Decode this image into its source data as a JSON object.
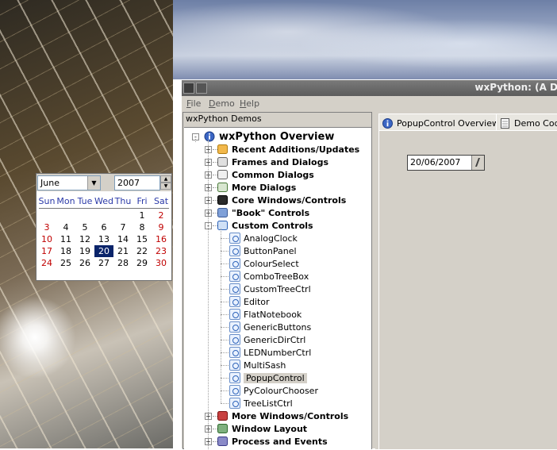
{
  "window": {
    "title": "wxPython: (A D",
    "menu": [
      {
        "accel": "F",
        "rest": "ile"
      },
      {
        "accel": "D",
        "rest": "emo"
      },
      {
        "accel": "H",
        "rest": "elp"
      }
    ]
  },
  "tree": {
    "caption": "wxPython Demos",
    "root": "wxPython Overview",
    "top_groups": [
      "Recent Additions/Updates",
      "Frames and Dialogs",
      "Common Dialogs",
      "More Dialogs",
      "Core Windows/Controls",
      "\"Book\" Controls",
      "Custom Controls"
    ],
    "custom_children": [
      "AnalogClock",
      "ButtonPanel",
      "ColourSelect",
      "ComboTreeBox",
      "CustomTreeCtrl",
      "Editor",
      "FlatNotebook",
      "GenericButtons",
      "GenericDirCtrl",
      "LEDNumberCtrl",
      "MultiSash",
      "PopupControl",
      "PyColourChooser",
      "TreeListCtrl"
    ],
    "selected": "PopupControl",
    "bottom_groups": [
      "More Windows/Controls",
      "Window Layout",
      "Process and Events"
    ]
  },
  "tabs": [
    {
      "label": "PopupControl Overview",
      "icon": "info-icon"
    },
    {
      "label": "Demo Code",
      "icon": "page-icon"
    }
  ],
  "demo": {
    "date_value": "20/06/2007"
  },
  "calendar": {
    "month": "June",
    "year": "2007",
    "weekdays": [
      "Sun",
      "Mon",
      "Tue",
      "Wed",
      "Thu",
      "Fri",
      "Sat"
    ],
    "weeks": [
      [
        "",
        "",
        "",
        "",
        "",
        "1",
        "2"
      ],
      [
        "3",
        "4",
        "5",
        "6",
        "7",
        "8",
        "9"
      ],
      [
        "10",
        "11",
        "12",
        "13",
        "14",
        "15",
        "16"
      ],
      [
        "17",
        "18",
        "19",
        "20",
        "21",
        "22",
        "23"
      ],
      [
        "24",
        "25",
        "26",
        "27",
        "28",
        "29",
        "30"
      ]
    ],
    "selected_day": "20"
  },
  "colors": {
    "selection": "#0a246a",
    "weekend": "#c00000",
    "weekday_header": "#2b3aa8",
    "window_bg": "#d4d0c8"
  }
}
